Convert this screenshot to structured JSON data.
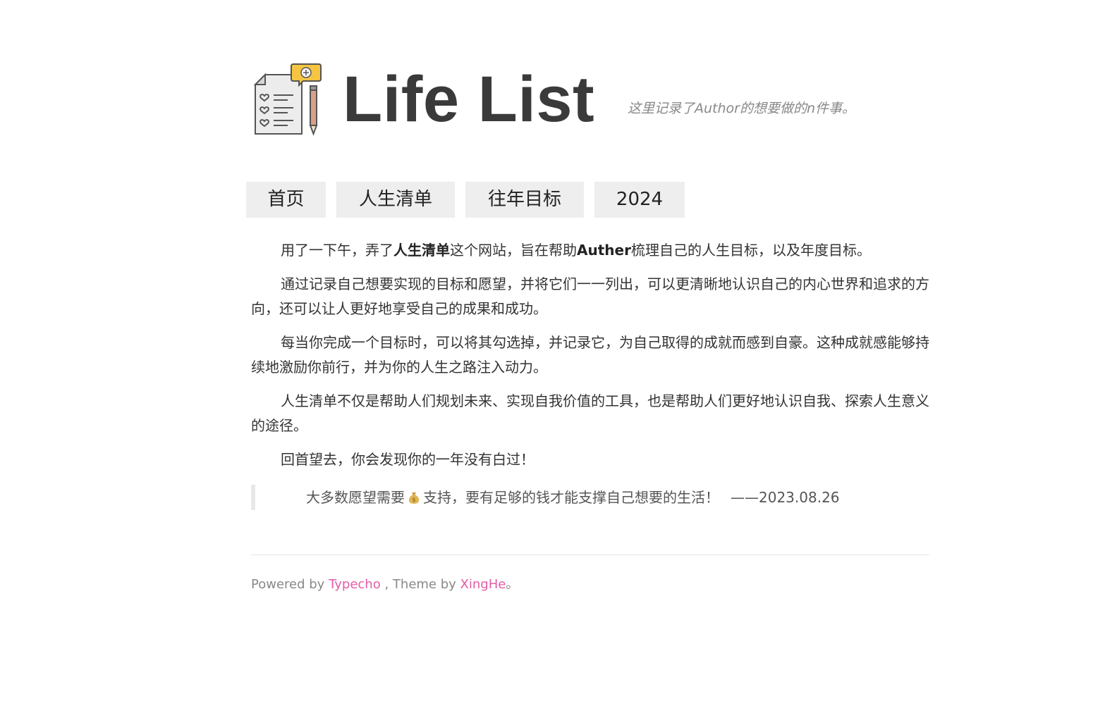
{
  "header": {
    "logo_icon": "checklist-pencil-icon",
    "title": "Life List",
    "tagline": "这里记录了Author的想要做的n件事。"
  },
  "nav": {
    "items": [
      {
        "label": "首页"
      },
      {
        "label": "人生清单"
      },
      {
        "label": "往年目标"
      },
      {
        "label": "2024"
      }
    ]
  },
  "content": {
    "p1": {
      "pre": "用了一下午，弄了",
      "bold1": "人生清单",
      "mid": "这个网站，旨在帮助",
      "bold2": "Auther",
      "post": "梳理自己的人生目标，以及年度目标。"
    },
    "p2": "通过记录自己想要实现的目标和愿望，并将它们一一列出，可以更清晰地认识自己的内心世界和追求的方向，还可以让人更好地享受自己的成果和成功。",
    "p3": "每当你完成一个目标时，可以将其勾选掉，并记录它，为自己取得的成就而感到自豪。这种成就感能够持续地激励你前行，并为你的人生之路注入动力。",
    "p4": "人生清单不仅是帮助人们规划未来、实现自我价值的工具，也是帮助人们更好地认识自我、探索人生意义的途径。",
    "p5": "回首望去，你会发现你的一年没有白过！",
    "quote": {
      "pre": "大多数愿望需要",
      "emoji_icon": "money-bag-icon",
      "post": "支持，要有足够的钱才能支撑自己想要的生活！",
      "date": "——2023.08.26"
    }
  },
  "footer": {
    "powered_by": "Powered by",
    "typecho": "Typecho",
    "theme_by": ", Theme by",
    "xinghe": "XingHe",
    "end": "。"
  },
  "colors": {
    "nav_bg": "#eeeeee",
    "link_pink": "#e35da6",
    "logo_yellow": "#f5c542",
    "pencil_brown": "#d9a088"
  }
}
